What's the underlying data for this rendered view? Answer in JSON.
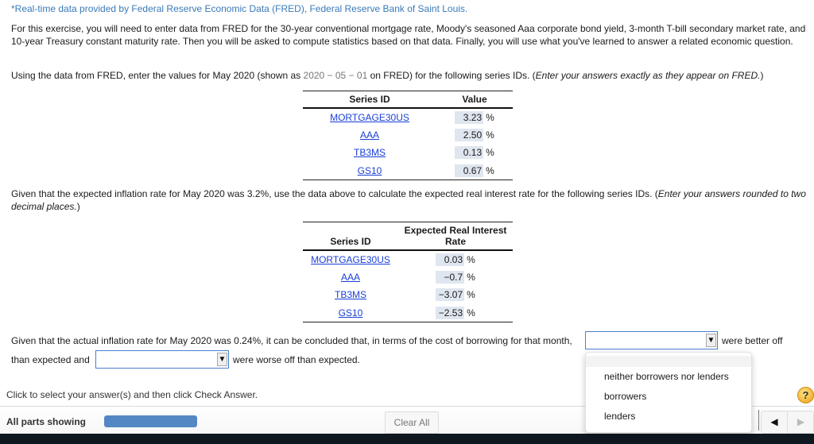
{
  "source_note": "*Real-time data provided by Federal Reserve Economic Data (FRED), Federal Reserve Bank of Saint Louis.",
  "intro": "For this exercise, you will need to enter data from FRED for the 30-year conventional mortgage rate, Moody's seasoned Aaa corporate bond yield, 3-month T-bill secondary market rate, and 10-year Treasury constant maturity rate. Then you will be asked to compute statistics based on that data. Finally, you will use what you've learned to answer a related economic question.",
  "part1": {
    "text_before": "Using the data from FRED, enter the values for May 2020 (shown as ",
    "date": "2020 − 05 − 01",
    "text_after": " on FRED) for the following series IDs. (",
    "instruction": "Enter your answers exactly as they appear on FRED.",
    "close": ")",
    "table": {
      "headers": [
        "Series ID",
        "Value"
      ],
      "rows": [
        {
          "series": "MORTGAGE30US",
          "value": "3.23",
          "unit": "%"
        },
        {
          "series": "AAA",
          "value": "2.50",
          "unit": "%"
        },
        {
          "series": "TB3MS",
          "value": "0.13",
          "unit": "%"
        },
        {
          "series": "GS10",
          "value": "0.67",
          "unit": "%"
        }
      ]
    }
  },
  "part2": {
    "text": "Given that the expected inflation rate for May 2020 was 3.2%, use the data above to calculate the expected real interest rate for the following series IDs. (",
    "instruction": "Enter your answers rounded to two decimal places.",
    "close": ")",
    "table": {
      "headers": [
        "Series ID",
        "Expected Real Interest Rate"
      ],
      "rows": [
        {
          "series": "MORTGAGE30US",
          "value": "0.03",
          "unit": "%"
        },
        {
          "series": "AAA",
          "value": "−0.7",
          "unit": "%"
        },
        {
          "series": "TB3MS",
          "value": "−3.07",
          "unit": "%"
        },
        {
          "series": "GS10",
          "value": "−2.53",
          "unit": "%"
        }
      ]
    }
  },
  "part3": {
    "text1": "Given that the actual inflation rate for May 2020 was 0.24%, it can be concluded that, in terms of the cost of borrowing for that month,",
    "after_dropdown1": "were better off",
    "text2": "than expected and",
    "after_dropdown2": "were worse off than expected.",
    "dropdown1_value": "",
    "dropdown2_value": "",
    "dropdown_options": [
      "",
      "neither borrowers nor lenders",
      "borrowers",
      "lenders"
    ]
  },
  "footer": {
    "hint": "Click to select your answer(s) and then click Check Answer.",
    "parts_label": "All parts showing",
    "progress_fraction": 1.0,
    "clear_all": "Clear All",
    "help": "?",
    "prev": "◀",
    "next": "▶"
  }
}
